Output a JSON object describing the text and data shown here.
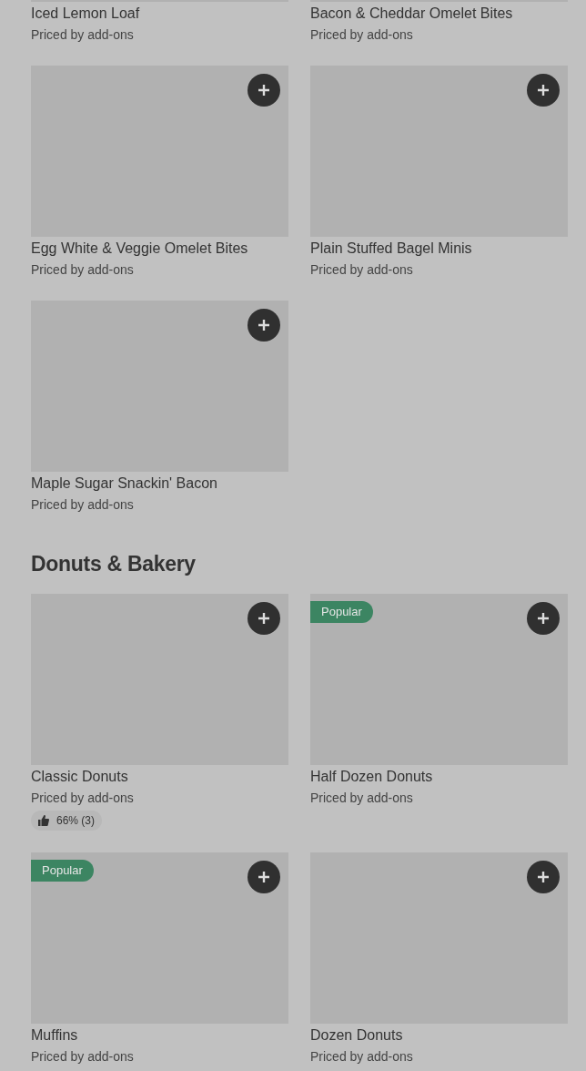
{
  "sections": [
    {
      "partial_row": [
        {
          "name": "Iced Lemon Loaf",
          "subtitle": "Priced by add-ons"
        },
        {
          "name": "Bacon & Cheddar Omelet Bites",
          "subtitle": "Priced by add-ons"
        }
      ],
      "items": [
        {
          "name": "Egg White & Veggie Omelet Bites",
          "subtitle": "Priced by add-ons"
        },
        {
          "name": "Plain Stuffed Bagel Minis",
          "subtitle": "Priced by add-ons"
        },
        {
          "name": "Maple Sugar Snackin' Bacon",
          "subtitle": "Priced by add-ons"
        }
      ]
    },
    {
      "title": "Donuts & Bakery",
      "items": [
        {
          "name": "Classic Donuts",
          "subtitle": "Priced by add-ons",
          "rating": "66% (3)"
        },
        {
          "name": "Half Dozen Donuts",
          "subtitle": "Priced by add-ons",
          "badge": "Popular"
        },
        {
          "name": "Muffins",
          "subtitle": "Priced by add-ons",
          "badge": "Popular"
        },
        {
          "name": "Dozen Donuts",
          "subtitle": "Priced by add-ons"
        }
      ]
    }
  ]
}
